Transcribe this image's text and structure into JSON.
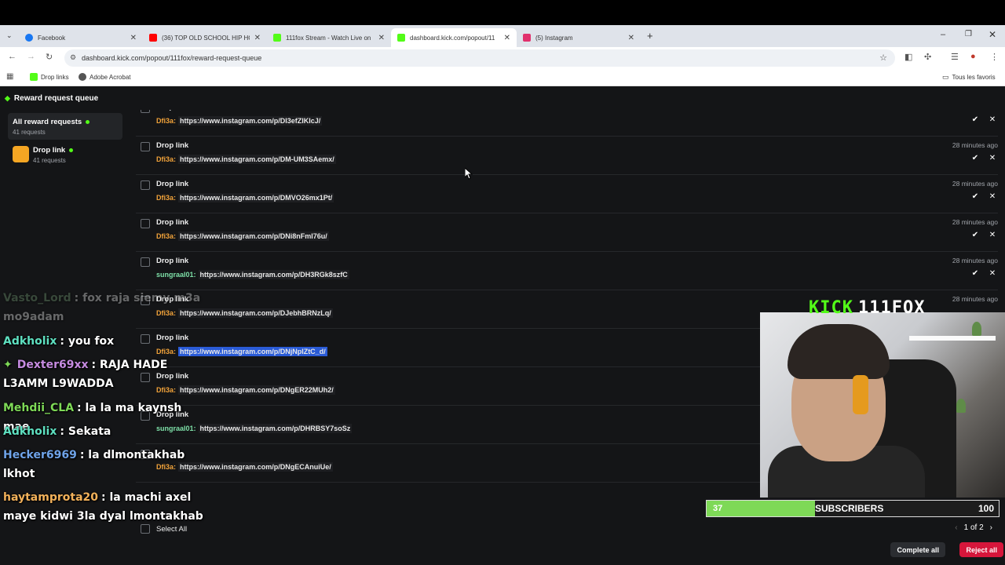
{
  "browser": {
    "tabs": [
      {
        "title": "Facebook",
        "icon": "facebook-icon",
        "color": "#1877f2"
      },
      {
        "title": "(36) TOP OLD SCHOOL HIP HOP",
        "icon": "youtube-icon",
        "color": "#ff0000"
      },
      {
        "title": "111fox Stream - Watch Live on",
        "icon": "kick-icon",
        "color": "#53fc18"
      },
      {
        "title": "dashboard.kick.com/popout/11",
        "icon": "kick-icon",
        "color": "#53fc18"
      },
      {
        "title": "(5) Instagram",
        "icon": "instagram-icon",
        "color": "#e1306c"
      }
    ],
    "url": "dashboard.kick.com/popout/111fox/reward-request-queue",
    "bookmarks": [
      {
        "label": "Drop links",
        "icon": "kick-icon"
      },
      {
        "label": "Adobe Acrobat",
        "icon": "acrobat-icon"
      }
    ],
    "all_bookmarks_label": "Tous les favoris"
  },
  "app": {
    "title": "Reward request queue",
    "sidebar": [
      {
        "name": "All reward requests",
        "count": "41 requests"
      },
      {
        "name": "Drop link",
        "count": "41 requests"
      }
    ],
    "requests": [
      {
        "title": "Drop link",
        "time": "",
        "user": "Dfi3a:",
        "user_color": "#f2a33a",
        "link": "https://www.instagram.com/p/DI3efZIKIcJ/"
      },
      {
        "title": "Drop link",
        "time": "28 minutes ago",
        "user": "Dfi3a:",
        "user_color": "#f2a33a",
        "link": "https://www.instagram.com/p/DM-UM3SAemx/"
      },
      {
        "title": "Drop link",
        "time": "28 minutes ago",
        "user": "Dfi3a:",
        "user_color": "#f2a33a",
        "link": "https://www.instagram.com/p/DMVO26mx1Pt/"
      },
      {
        "title": "Drop link",
        "time": "28 minutes ago",
        "user": "Dfi3a:",
        "user_color": "#f2a33a",
        "link": "https://www.instagram.com/p/DNi8nFmI76u/"
      },
      {
        "title": "Drop link",
        "time": "28 minutes ago",
        "user": "sungraal01:",
        "user_color": "#7ee0a8",
        "link": "https://www.instagram.com/p/DH3RGk8szfC"
      },
      {
        "title": "Drop link",
        "time": "28 minutes ago",
        "user": "Dfi3a:",
        "user_color": "#f2a33a",
        "link": "https://www.instagram.com/p/DJebhBRNzLq/"
      },
      {
        "title": "Drop link",
        "time": "",
        "user": "Dfi3a:",
        "user_color": "#f2a33a",
        "link": "https://www.instagram.com/p/DNjNpIZtC_d/"
      },
      {
        "title": "Drop link",
        "time": "",
        "user": "Dfi3a:",
        "user_color": "#f2a33a",
        "link": "https://www.instagram.com/p/DNgER22MUh2/"
      },
      {
        "title": "Drop link",
        "time": "",
        "user": "sungraal01:",
        "user_color": "#7ee0a8",
        "link": "https://www.instagram.com/p/DHRBSY7soSz"
      },
      {
        "title": "",
        "time": "",
        "user": "Dfi3a:",
        "user_color": "#f2a33a",
        "link": "https://www.instagram.com/p/DNgECAnuiUe/"
      }
    ],
    "select_all": "Select All",
    "pagination": "1 of 2",
    "complete_all": "Complete all",
    "reject_all": "Reject all"
  },
  "overlay": {
    "chat": [
      {
        "user": "Vasto_Lord",
        "color": "#7ba77b",
        "msg": ": fox raja siemy m3a mo9adam",
        "faded": true
      },
      {
        "user": "Adkholix",
        "color": "#5ee0c0",
        "msg": ": you fox"
      },
      {
        "user": "Dexter69xx",
        "color": "#c58be0",
        "msg": ": RAJA HADE L3AMM L9WADDA",
        "badge": "✦"
      },
      {
        "user": "Mehdii_CLA",
        "color": "#7ed957",
        "msg": ": la la ma kaynsh mae"
      },
      {
        "user": "Adkholix",
        "color": "#5ee0c0",
        "msg": ": Sekata"
      },
      {
        "user": "Hecker6969",
        "color": "#6fa3e8",
        "msg": ": la dlmontakhab lkhot"
      },
      {
        "user": "haytamprota20",
        "color": "#f2b15a",
        "msg": ": la machi axel maye kidwi 3la dyal lmontakhab"
      }
    ],
    "logo_kick": "KICK",
    "logo_channel": "111FOX",
    "subs": {
      "current": "37",
      "label": "SUBSCRIBERS",
      "goal": "100",
      "progress": 0.37,
      "fill_color": "#7ed957"
    }
  }
}
